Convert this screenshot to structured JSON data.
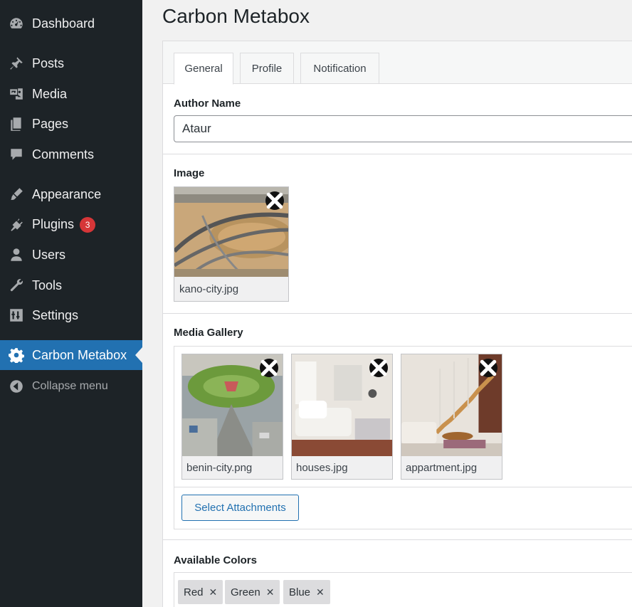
{
  "sidebar": {
    "items": [
      {
        "label": "Dashboard",
        "icon": "dashboard-icon"
      },
      {
        "label": "Posts",
        "icon": "pin-icon"
      },
      {
        "label": "Media",
        "icon": "media-icon"
      },
      {
        "label": "Pages",
        "icon": "pages-icon"
      },
      {
        "label": "Comments",
        "icon": "comment-icon"
      },
      {
        "label": "Appearance",
        "icon": "brush-icon"
      },
      {
        "label": "Plugins",
        "icon": "plug-icon",
        "badge": "3"
      },
      {
        "label": "Users",
        "icon": "user-icon"
      },
      {
        "label": "Tools",
        "icon": "wrench-icon"
      },
      {
        "label": "Settings",
        "icon": "settings-icon"
      },
      {
        "label": "Carbon Metabox",
        "icon": "gear-icon",
        "active": true
      },
      {
        "label": "Collapse menu",
        "icon": "collapse-icon"
      }
    ]
  },
  "page": {
    "title": "Carbon Metabox"
  },
  "tabs": [
    {
      "label": "General",
      "active": true
    },
    {
      "label": "Profile"
    },
    {
      "label": "Notification"
    }
  ],
  "fields": {
    "author": {
      "label": "Author Name",
      "value": "Ataur"
    },
    "image": {
      "label": "Image",
      "filename": "kano-city.jpg"
    },
    "gallery": {
      "label": "Media Gallery",
      "items": [
        {
          "filename": "benin-city.png"
        },
        {
          "filename": "houses.jpg"
        },
        {
          "filename": "appartment.jpg"
        }
      ],
      "button_label": "Select Attachments"
    },
    "colors": {
      "label": "Available Colors",
      "tags": [
        "Red",
        "Green",
        "Blue"
      ]
    }
  },
  "colors": {
    "sidebar_bg": "#1d2327",
    "accent": "#2271b1",
    "badge": "#d63638"
  }
}
